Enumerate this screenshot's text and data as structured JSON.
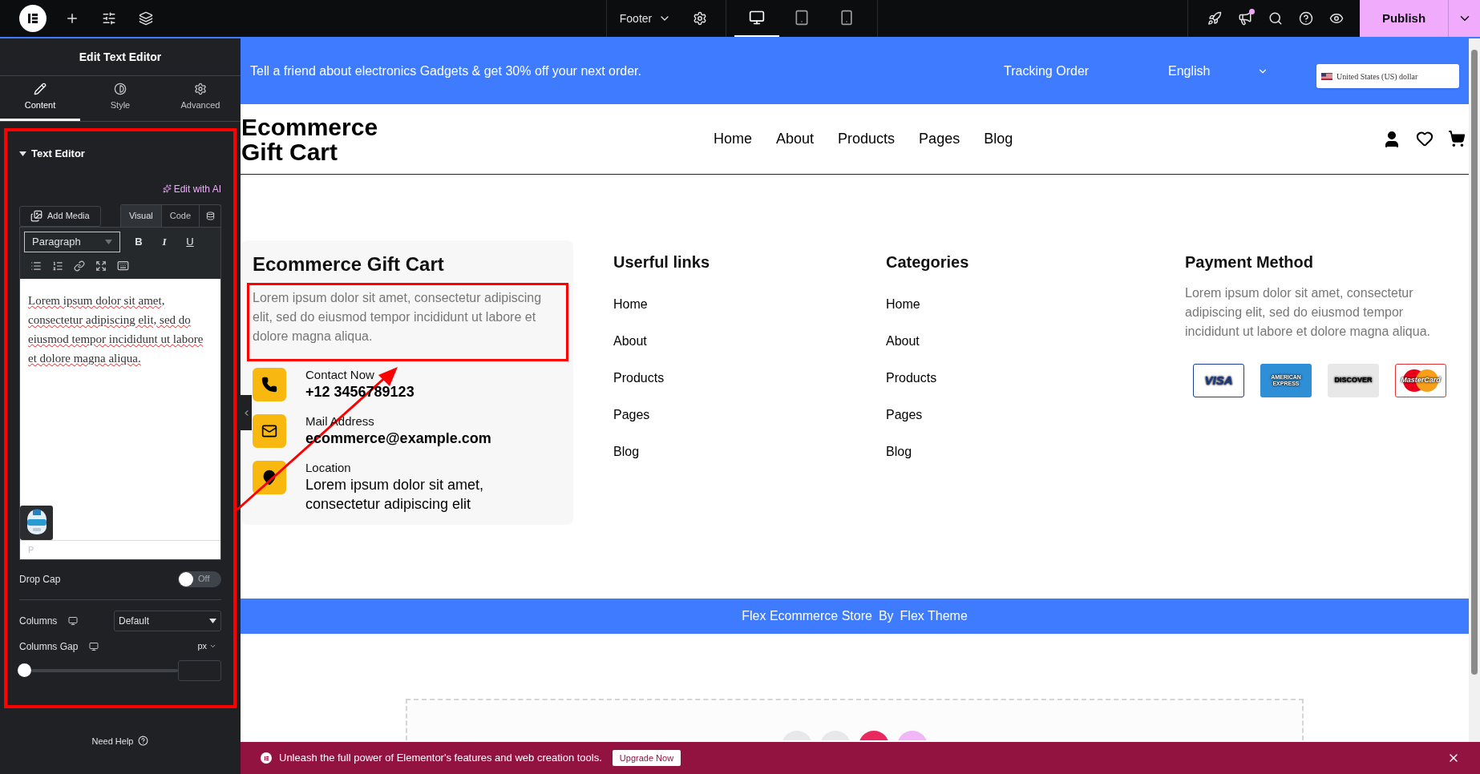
{
  "top_bar": {
    "document": "Footer",
    "devices": [
      {
        "kind": "desktop",
        "selected": true
      },
      {
        "kind": "tablet",
        "selected": false
      },
      {
        "kind": "mobile",
        "selected": false
      }
    ],
    "publish": "Publish"
  },
  "panel": {
    "title": "Edit Text Editor",
    "tabs": [
      {
        "kind": "content",
        "label": "Content",
        "selected": true
      },
      {
        "kind": "style",
        "label": "Style",
        "selected": false
      },
      {
        "kind": "advanced",
        "label": "Advanced",
        "selected": false
      }
    ],
    "section": "Text Editor",
    "ai_link": "Edit with AI",
    "add_media": "Add Media",
    "modes": [
      {
        "label": "Visual",
        "selected": true
      },
      {
        "label": "Code",
        "selected": false
      }
    ],
    "format": "Paragraph",
    "format_buttons": [
      "B",
      "I",
      "U"
    ],
    "content": "Lorem ipsum dolor sit amet, consectetur adipiscing elit, sed do eiusmod tempor incididunt ut labore et dolore magna aliqua.",
    "path": "P",
    "drop_cap": {
      "label": "Drop Cap",
      "on": false,
      "state": "Off"
    },
    "columns": {
      "label": "Columns",
      "value": "Default"
    },
    "columns_gap": {
      "label": "Columns Gap",
      "unit": "px",
      "level": 0
    },
    "help": "Need Help"
  },
  "preview": {
    "promo": "Tell a friend about electronics Gadgets & get 30% off your next order.",
    "tracking": "Tracking Order",
    "language": "English",
    "currency": "United States (US) dollar",
    "logo": [
      "Ecommerce",
      "Gift Cart"
    ],
    "nav": [
      "Home",
      "About",
      "Products",
      "Pages",
      "Blog"
    ],
    "about": {
      "title": "Ecommerce Gift Cart",
      "text": "Lorem ipsum dolor sit amet, consectetur adipiscing elit, sed do eiusmod tempor incididunt ut labore et dolore magna aliqua.",
      "contacts": [
        {
          "kind": "phone",
          "label": "Contact Now",
          "value": "+12 3456789123"
        },
        {
          "kind": "mail",
          "label": "Mail Address",
          "value": "ecommerce@example.com"
        },
        {
          "kind": "location",
          "label": "Location",
          "value": "Lorem ipsum dolor sit amet, consectetur adipiscing elit"
        }
      ]
    },
    "link_columns": [
      {
        "title": "Userful links",
        "items": [
          "Home",
          "About",
          "Products",
          "Pages",
          "Blog"
        ]
      },
      {
        "title": "Categories",
        "items": [
          "Home",
          "About",
          "Products",
          "Pages",
          "Blog"
        ]
      }
    ],
    "payment": {
      "title": "Payment Method",
      "text": "Lorem ipsum dolor sit amet, consectetur adipiscing elit, sed do eiusmod tempor incididunt ut labore et dolore magna aliqua.",
      "cards": [
        {
          "kind": "visa",
          "label": "VISA"
        },
        {
          "kind": "amex",
          "label": "AMERICAN EXPRESS"
        },
        {
          "kind": "discover",
          "label": "DISCOVER"
        },
        {
          "kind": "mastercard",
          "label": "MasterCard"
        }
      ]
    },
    "copyright": [
      "Flex Ecommerce Store",
      "By",
      "Flex Theme"
    ]
  },
  "banner": {
    "text": "Unleash the full power of Elementor's features and web creation tools.",
    "button": "Upgrade Now"
  }
}
